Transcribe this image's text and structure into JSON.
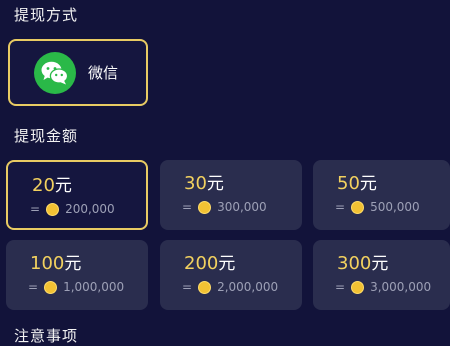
{
  "sections": {
    "method_title": "提现方式",
    "amount_title": "提现金额",
    "notes_title": "注意事项"
  },
  "method": {
    "label": "微信",
    "icon": "wechat-icon",
    "selected": true
  },
  "amounts": [
    {
      "value": "20",
      "unit": "元",
      "eq": "=",
      "coins": "200,000",
      "selected": true
    },
    {
      "value": "30",
      "unit": "元",
      "eq": "=",
      "coins": "300,000",
      "selected": false
    },
    {
      "value": "50",
      "unit": "元",
      "eq": "=",
      "coins": "500,000",
      "selected": false
    },
    {
      "value": "100",
      "unit": "元",
      "eq": "=",
      "coins": "1,000,000",
      "selected": false
    },
    {
      "value": "200",
      "unit": "元",
      "eq": "=",
      "coins": "2,000,000",
      "selected": false
    },
    {
      "value": "300",
      "unit": "元",
      "eq": "=",
      "coins": "3,000,000",
      "selected": false
    }
  ],
  "colors": {
    "background": "#12133a",
    "card": "#2a2d4e",
    "accent_border": "#e8cb63",
    "amount_number": "#f2d15f",
    "wechat_green": "#2ab948",
    "coin": "#f3c233"
  }
}
